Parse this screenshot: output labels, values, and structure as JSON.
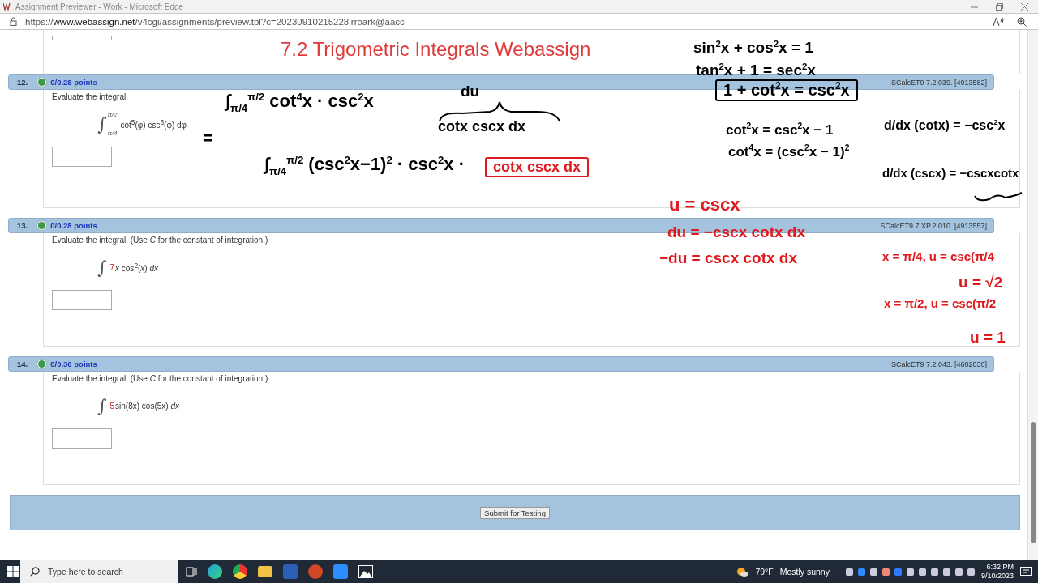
{
  "window": {
    "title": "Assignment Previewer - Work - Microsoft Edge"
  },
  "address_bar": {
    "url": "https://**www.webassign.net**/v4cgi/assignments/preview.tpl?c=20230910215228lrroark@aacc"
  },
  "page_title": "7.2 Trigometric Integrals Webassign",
  "questions": [
    {
      "number": "12.",
      "points": "0/0.28 points",
      "code": "SCalcET9 7.2.039. [4913582]",
      "prompt": "Evaluate the integral.",
      "integral": {
        "sign": "∫",
        "upper": "π/2",
        "lower": "π/4",
        "integrand": "cot$^{5}$(φ) csc$^{3}$(φ) dφ"
      }
    },
    {
      "number": "13.",
      "points": "0/0.28 points",
      "code": "SCalcET9 7.XP.2.010. [4913557]",
      "prompt": "Evaluate the integral. (Use *C* for the constant of integration.)",
      "integral": {
        "sign": "∫",
        "coefficient": "7",
        "integrand": "*x* cos$^{2}$(*x*) *dx*"
      }
    },
    {
      "number": "14.",
      "points": "0/0.36 points",
      "code": "SCalcET9 7.2.043. [4602030]",
      "prompt": "Evaluate the integral. (Use *C* for the constant of integration.)",
      "integral": {
        "sign": "∫",
        "coefficient": "5",
        "integrand": "sin(8x) cos(5x) *dx*"
      }
    }
  ],
  "submit_button": "Submit for Testing",
  "annotations": [
    {
      "text": "sin$^{2}$x + cos$^{2}$x = 1",
      "color": "#000000",
      "boxed": false
    },
    {
      "text": "tan$^{2}$x + 1 = sec$^{2}$x",
      "color": "#000000",
      "boxed": false
    },
    {
      "text": "du",
      "color": "#000000",
      "boxed": false
    },
    {
      "text": "1 + cot$^{2}$x = csc$^{2}$x",
      "color": "#000000",
      "boxed": true
    },
    {
      "text": "∫$_{π/4}$$^{π/2}$ cot$^{4}$x · csc$^{2}$x",
      "color": "#000000",
      "boxed": false
    },
    {
      "text": "=",
      "color": "#000000",
      "boxed": false
    },
    {
      "text": "cotx cscx dx",
      "color": "#000000",
      "boxed": false
    },
    {
      "text": "cot$^{2}$x = csc$^{2}$x − 1",
      "color": "#000000",
      "boxed": false
    },
    {
      "text": "d/dx (cotx) = −csc$^{2}$x",
      "color": "#000000",
      "boxed": false
    },
    {
      "text": "cot$^{4}$x = (csc$^{2}$x − 1)$^{2}$",
      "color": "#000000",
      "boxed": false
    },
    {
      "text": "∫$_{π/4}$$^{π/2}$ (csc$^{2}$x−1)$^{2}$ · csc$^{2}$x ·",
      "color": "#000000",
      "boxed": false
    },
    {
      "text": "cotx cscx dx",
      "color": "#e0191f",
      "boxed": true
    },
    {
      "text": "d/dx (cscx) = −cscxcotx",
      "color": "#000000",
      "boxed": false
    },
    {
      "text": "u = cscx",
      "color": "#e0191f",
      "boxed": false
    },
    {
      "text": "du = −cscx cotx dx",
      "color": "#e0191f",
      "boxed": false
    },
    {
      "text": "−du = cscx cotx dx",
      "color": "#e0191f",
      "boxed": false
    },
    {
      "text": "x = π/4, u = csc(π/4",
      "color": "#e0191f",
      "boxed": false
    },
    {
      "text": "u = √2",
      "color": "#e0191f",
      "boxed": false
    },
    {
      "text": "x = π/2, u = csc(π/2",
      "color": "#e0191f",
      "boxed": false
    },
    {
      "text": "u = 1",
      "color": "#e0191f",
      "boxed": false
    }
  ],
  "taskbar": {
    "search_placeholder": "Type here to search",
    "temperature": "79°F",
    "weather": "Mostly sunny",
    "time": "6:32 PM",
    "date": "9/10/2023"
  }
}
